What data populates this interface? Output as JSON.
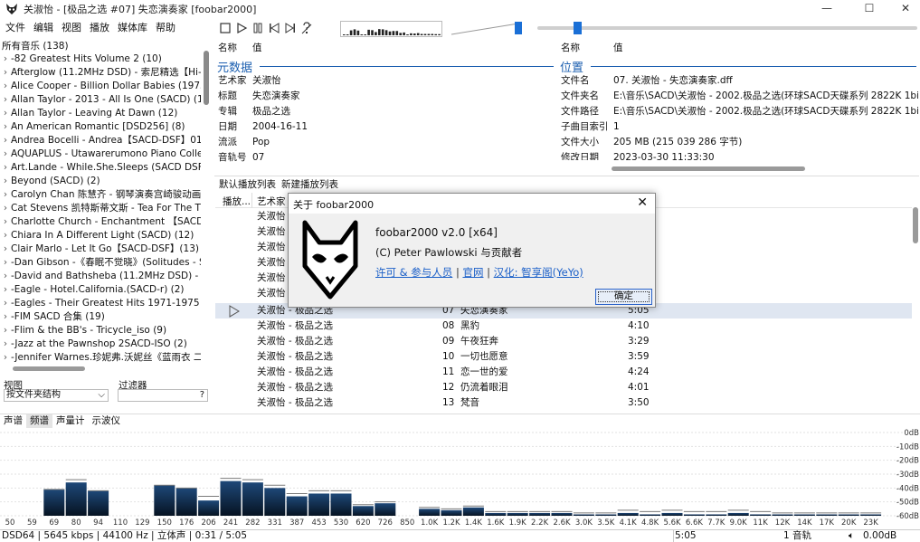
{
  "window": {
    "title": "关淑怡 - [极品之选 #07] 失恋演奏家  [foobar2000]",
    "minimize": "—",
    "maximize": "☐",
    "close": "✕"
  },
  "menu": [
    "文件",
    "编辑",
    "视图",
    "播放",
    "媒体库",
    "帮助"
  ],
  "library": {
    "root": "所有音乐 (138)",
    "items": [
      "-82 Greatest Hits Volume 2 (10)",
      "Afterglow (11.2MHz DSD) - 索尼精选【Hi-",
      "Alice Cooper - Billion Dollar Babies (1973)",
      "Allan Taylor - 2013 - All Is One (SACD) (10",
      "Allan Taylor - Leaving At Dawn (12)",
      "An American Romantic [DSD256] (8)",
      "Andrea Bocelli - Andrea【SACD-DSF】01 -",
      "AQUAPLUS - Utawarerumono Piano Collec",
      "Art.Lande - While.She.Sleeps  (SACD DSF)",
      "Beyond  (SACD)  (2)",
      "Carolyn Chan 陈慧齐 - 钢琴演奏宫崎骏动画",
      "Cat Stevens 凯特斯蒂文斯 - Tea For The Till",
      "Charlotte Church - Enchantment 【SACD-",
      "Chiara In A Different Light (SACD) (12)",
      "Clair Marlo - Let It Go【SACD-DSF】(13)",
      "-Dan Gibson -《春眠不觉晓》(Solitudes - Sc",
      "-David and Bathsheba (11.2MHz DSD) - 索",
      "-Eagle - Hotel.California.(SACD-r) (2)",
      "-Eagles - Their Greatest Hits 1971-1975 (10",
      "-FIM SACD 合集 (19)",
      "-Flim & the BB's - Tricycle_iso (9)",
      "-Jazz at the Pawnshop 2SACD-ISO (2)",
      "-Jennifer Warnes.珍妮弗.沃妮丝《蓝雨衣 二十"
    ]
  },
  "filters": {
    "view_label": "视图",
    "view_value": "按文件夹结构",
    "filter_label": "过滤器",
    "filter_placeholder": "?"
  },
  "meta_panel": {
    "col_name": "名称",
    "col_value": "值",
    "section": "元数据",
    "rows": [
      {
        "k": "艺术家",
        "v": "关淑怡"
      },
      {
        "k": "标题",
        "v": "失恋演奏家"
      },
      {
        "k": "专辑",
        "v": "极品之选"
      },
      {
        "k": "日期",
        "v": "2004-16-11"
      },
      {
        "k": "流派",
        "v": "Pop"
      },
      {
        "k": "音轨号",
        "v": "07"
      }
    ]
  },
  "location_panel": {
    "col_name": "名称",
    "col_value": "值",
    "section": "位置",
    "rows": [
      {
        "k": "文件名",
        "v": "07. 关淑怡 - 失恋演奏家.dff"
      },
      {
        "k": "文件夹名",
        "v": "E:\\音乐\\SACD\\关淑怡 - 2002.极品之选(环球SACD天碟系列 2822K 1bit"
      },
      {
        "k": "文件路径",
        "v": "E:\\音乐\\SACD\\关淑怡 - 2002.极品之选(环球SACD天碟系列 2822K 1bit"
      },
      {
        "k": "子曲目索引",
        "v": "1"
      },
      {
        "k": "文件大小",
        "v": "205 MB (215 039 286 字节)"
      },
      {
        "k": "修改日期",
        "v": "2023-03-30 11:33:30"
      }
    ]
  },
  "playlist_tabs": [
    "默认播放列表",
    "新建播放列表"
  ],
  "playlist": {
    "col_playing": "播放...",
    "col_artist": "艺术家",
    "hidden_rows": [
      "关淑怡",
      "关淑怡",
      "关淑怡",
      "关淑怡",
      "关淑怡",
      "关淑怡"
    ],
    "rows": [
      {
        "artist": "关淑怡 - 极品之选",
        "num": "07",
        "title": "失恋演奏家",
        "dur": "5:05",
        "playing": true
      },
      {
        "artist": "关淑怡 - 极品之选",
        "num": "08",
        "title": "黑豹",
        "dur": "4:10"
      },
      {
        "artist": "关淑怡 - 极品之选",
        "num": "09",
        "title": "午夜狂奔",
        "dur": "3:29"
      },
      {
        "artist": "关淑怡 - 极品之选",
        "num": "10",
        "title": "一切也愿意",
        "dur": "3:59"
      },
      {
        "artist": "关淑怡 - 极品之选",
        "num": "11",
        "title": "恋一世的爱",
        "dur": "4:24"
      },
      {
        "artist": "关淑怡 - 极品之选",
        "num": "12",
        "title": "仍流着眼泪",
        "dur": "4:01"
      },
      {
        "artist": "关淑怡 - 极品之选",
        "num": "13",
        "title": "梵音",
        "dur": "3:50"
      }
    ]
  },
  "dialog": {
    "title": "关于 foobar2000",
    "close": "✕",
    "version": "foobar2000 v2.0 [x64]",
    "copyright": "(C) Peter Pawlowski 与贡献者",
    "link1": "许可 & 参与人员",
    "link2": "官网",
    "link3": "汉化: 智享阁(YeYo)",
    "sep": "|",
    "ok": "确定"
  },
  "vis_tabs": [
    "声谱",
    "频谱",
    "声量计",
    "示波仪"
  ],
  "vis_active": 1,
  "spectrum": {
    "freq_labels": [
      "50",
      "59",
      "69",
      "80",
      "94",
      "110",
      "129",
      "150",
      "176",
      "206",
      "241",
      "282",
      "331",
      "387",
      "453",
      "530",
      "620",
      "726",
      "850",
      "1.0K",
      "1.2K",
      "1.4K",
      "1.6K",
      "1.9K",
      "2.2K",
      "2.6K",
      "3.0K",
      "3.5K",
      "4.1K",
      "4.8K",
      "5.6K",
      "6.6K",
      "7.7K",
      "9.0K",
      "11K",
      "12K",
      "14K",
      "17K",
      "20K",
      "23K"
    ],
    "db_labels": [
      "0dB",
      "-10dB",
      "-20dB",
      "-30dB",
      "-40dB",
      "-50dB",
      "-60dB"
    ],
    "levels_db": [
      -60,
      -60,
      -41,
      -36,
      -42,
      -60,
      -60,
      -38,
      -40,
      -49,
      -35,
      -36,
      -40,
      -46,
      -44,
      -44,
      -53,
      -51,
      -60,
      -55,
      -56,
      -54,
      -58,
      -58,
      -58,
      -58,
      -59,
      -59,
      -58,
      -59,
      -58,
      -59,
      -59,
      -58,
      -59,
      -59,
      -59,
      -59,
      -59,
      -59
    ],
    "peaks_db": [
      -60,
      -60,
      -41,
      -34,
      -42,
      -60,
      -60,
      -38,
      -40,
      -46,
      -33,
      -34,
      -38,
      -44,
      -42,
      -42,
      -52,
      -50,
      -60,
      -54,
      -55,
      -53,
      -57,
      -57,
      -57,
      -57,
      -58,
      -58,
      -56,
      -57,
      -56,
      -57,
      -57,
      -56,
      -57,
      -58,
      -58,
      -58,
      -58,
      -58
    ]
  },
  "status": {
    "left": "DSD64 | 5645 kbps | 44100 Hz | 立体声 | 0:31 / 5:05",
    "time": "5:05",
    "tracks": "1 音轨",
    "volume": "0.00dB"
  },
  "colors": {
    "accent": "#1c5fb0",
    "bar_top": "#1e4878",
    "bar_bottom": "#061322"
  }
}
